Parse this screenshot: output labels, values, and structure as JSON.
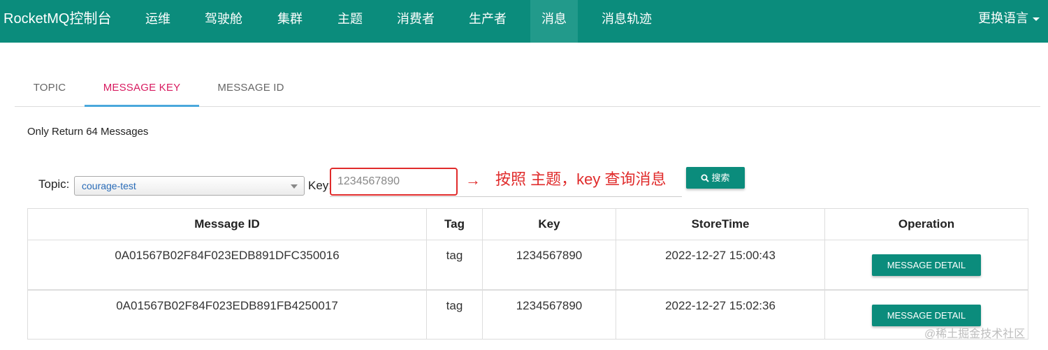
{
  "nav": {
    "brand": "RocketMQ控制台",
    "items": [
      {
        "label": "运维"
      },
      {
        "label": "驾驶舱"
      },
      {
        "label": "集群"
      },
      {
        "label": "主题"
      },
      {
        "label": "消费者"
      },
      {
        "label": "生产者"
      },
      {
        "label": "消息"
      },
      {
        "label": "消息轨迹"
      }
    ],
    "active_item": "消息",
    "language": "更换语言"
  },
  "tabs": [
    {
      "label": "TOPIC"
    },
    {
      "label": "MESSAGE KEY"
    },
    {
      "label": "MESSAGE ID"
    }
  ],
  "active_tab": "MESSAGE KEY",
  "note": "Only Return 64 Messages",
  "search": {
    "topic_label": "Topic:",
    "topic_value": "courage-test",
    "key_label": "Key:",
    "key_value": "1234567890",
    "button_label": "搜索"
  },
  "annotation": {
    "arrow": "→",
    "text": "按照 主题，key 查询消息"
  },
  "table": {
    "headers": [
      "Message ID",
      "Tag",
      "Key",
      "StoreTime",
      "Operation"
    ],
    "rows": [
      {
        "message_id": "0A01567B02F84F023EDB891DFC350016",
        "tag": "tag",
        "key": "1234567890",
        "store_time": "2022-12-27 15:00:43",
        "action": "MESSAGE DETAIL"
      },
      {
        "message_id": "0A01567B02F84F023EDB891FB4250017",
        "tag": "tag",
        "key": "1234567890",
        "store_time": "2022-12-27 15:02:36",
        "action": "MESSAGE DETAIL"
      }
    ]
  },
  "watermark": "@稀土掘金技术社区",
  "colors": {
    "navbar": "#0b8c7c",
    "active_tab": "#d81b60",
    "tab_indicator": "#4aa8dc",
    "annotation": "#e02b2b",
    "button": "#0b8c7c"
  },
  "icons": {
    "search_button": "search-icon",
    "language_dropdown": "caret-down-icon",
    "topic_select": "select-arrow-icon"
  }
}
